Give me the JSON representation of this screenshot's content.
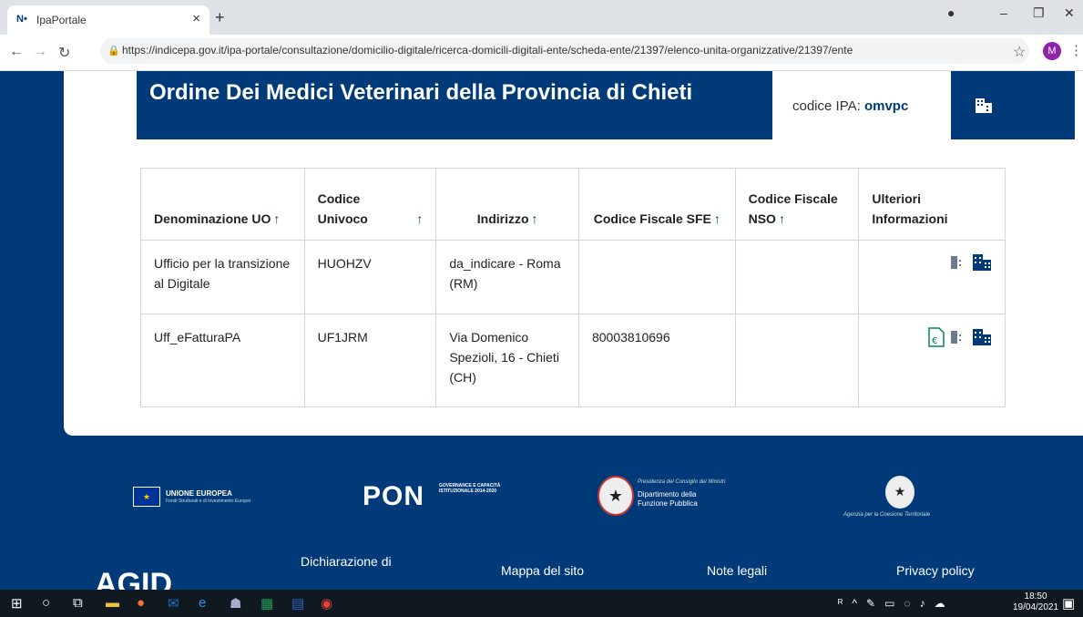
{
  "browser": {
    "tab_favicon": "N•",
    "tab_title": "IpaPortale",
    "tab_close": "×",
    "new_tab": "+",
    "url": "https://indicepa.gov.it/ipa-portale/consultazione/domicilio-digitale/ricerca-domicili-digitali-ente/scheda-ente/21397/elenco-unita-organizzative/21397/ente",
    "avatar_letter": "M"
  },
  "hero": {
    "title": "Ordine Dei Medici Veterinari della Provincia di Chieti",
    "ipa_label": "codice IPA: ",
    "ipa_code": "omvpc"
  },
  "table": {
    "headers": [
      "Denominazione UO",
      "Codice Univoco",
      "Indirizzo",
      "Codice Fiscale SFE",
      "Codice Fiscale NSO",
      "Ulteriori Informazioni"
    ],
    "sort_arrow": "↑",
    "rows": [
      {
        "denominazione": "Ufficio per la transizione al Digitale",
        "codice": "HUOHZV",
        "indirizzo": "da_indicare - Roma (RM)",
        "cf_sfe": "",
        "cf_nso": ""
      },
      {
        "denominazione": "Uff_eFatturaPA",
        "codice": "UF1JRM",
        "indirizzo": "Via Domenico Spezioli, 16 - Chieti (CH)",
        "cf_sfe": "80003810696",
        "cf_nso": ""
      }
    ]
  },
  "footer": {
    "eu_title": "UNIONE EUROPEA",
    "eu_sub": "Fondi Strutturali e di Investimento Europei",
    "pon": "PON",
    "pon_sub": "GOVERNANCE E CAPACITÀ ISTITUZIONALE 2014-2020",
    "dfp_small": "Presidenza del Consiglio dei Ministri",
    "dfp_line1": "Dipartimento della",
    "dfp_line2": "Funzione Pubblica",
    "act_text": "Agenzia per la Coesione Territoriale",
    "agid": "AGID",
    "links": [
      "Dichiarazione di",
      "Mappa del sito",
      "Note legali",
      "Privacy policy"
    ]
  },
  "taskbar": {
    "time": "18:50",
    "date": "19/04/2021"
  },
  "colors": {
    "brand": "#003a78",
    "link_icon": "#003a78"
  }
}
